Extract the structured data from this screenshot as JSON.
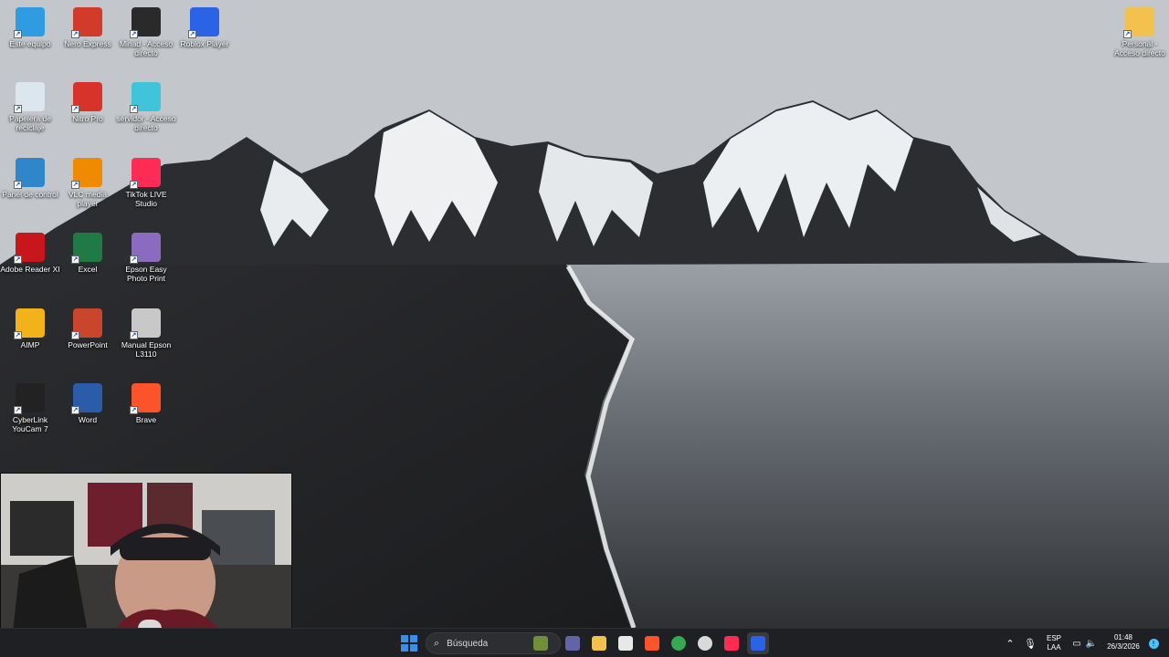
{
  "desktop": {
    "icons_left": [
      {
        "label": "Este equipo",
        "icon": "computer-icon",
        "color": "#2f9be0"
      },
      {
        "label": "Nero Express",
        "icon": "nero-icon",
        "color": "#d23b2a"
      },
      {
        "label": "Minad - Acceso directo",
        "icon": "minecraft-launcher-icon",
        "color": "#2a2a2a"
      },
      {
        "label": "Roblox Player",
        "icon": "roblox-icon",
        "color": "#2b63e6"
      },
      {
        "label": "Papelera de reciclaje",
        "icon": "recycle-bin-icon",
        "color": "#dce6ef"
      },
      {
        "label": "Nitro Pro",
        "icon": "nitro-pro-icon",
        "color": "#d8332a"
      },
      {
        "label": "servidor - Acceso directo",
        "icon": "server-icon",
        "color": "#3fc4d9"
      },
      {
        "label": "Panel de control",
        "icon": "control-panel-icon",
        "color": "#2f86c9"
      },
      {
        "label": "VLC media player",
        "icon": "vlc-icon",
        "color": "#f08a00"
      },
      {
        "label": "TikTok LIVE Studio",
        "icon": "tiktok-live-icon",
        "color": "#fe2c55"
      },
      {
        "label": "Adobe Reader XI",
        "icon": "adobe-reader-icon",
        "color": "#c8161d"
      },
      {
        "label": "Excel",
        "icon": "excel-icon",
        "color": "#1f7a44"
      },
      {
        "label": "Epson Easy Photo Print",
        "icon": "epson-photo-icon",
        "color": "#8a6bbf"
      },
      {
        "label": "AIMP",
        "icon": "aimp-icon",
        "color": "#f2b21a"
      },
      {
        "label": "PowerPoint",
        "icon": "powerpoint-icon",
        "color": "#c9452b"
      },
      {
        "label": "Manual Epson L3110",
        "icon": "manual-icon",
        "color": "#c8c8c8"
      },
      {
        "label": "CyberLink YouCam 7",
        "icon": "youcam-icon",
        "color": "#222222"
      },
      {
        "label": "Word",
        "icon": "word-icon",
        "color": "#2a5caa"
      },
      {
        "label": "Brave",
        "icon": "brave-icon",
        "color": "#fb542b"
      }
    ],
    "icon_right": {
      "label": "Personal - Acceso directo",
      "icon": "folder-icon",
      "color": "#f2c14e"
    }
  },
  "taskbar": {
    "search_placeholder": "Búsqueda",
    "apps": [
      {
        "name": "start-button",
        "icon": "windows-icon",
        "color": "#3b8eea"
      },
      {
        "name": "widgets-button",
        "icon": "widgets-icon",
        "color": "#6f8f3a"
      },
      {
        "name": "teams-button",
        "icon": "chat-icon",
        "color": "#6264a7"
      },
      {
        "name": "file-explorer-button",
        "icon": "folder-icon",
        "color": "#f2c14e"
      },
      {
        "name": "store-button",
        "icon": "store-icon",
        "color": "#e8e8e8"
      },
      {
        "name": "brave-button",
        "icon": "brave-icon",
        "color": "#fb542b"
      },
      {
        "name": "chrome-button",
        "icon": "chrome-icon",
        "color": "#34a853"
      },
      {
        "name": "obs-button",
        "icon": "recording-icon",
        "color": "#d9d9d9"
      },
      {
        "name": "tiktok-button",
        "icon": "tiktok-icon",
        "color": "#fe2c55"
      },
      {
        "name": "roblox-button",
        "icon": "roblox-icon",
        "color": "#2b63e6"
      }
    ],
    "tray": {
      "language_top": "ESP",
      "language_bottom": "LAA",
      "time": "01:48",
      "date": "26/3/2026"
    }
  }
}
